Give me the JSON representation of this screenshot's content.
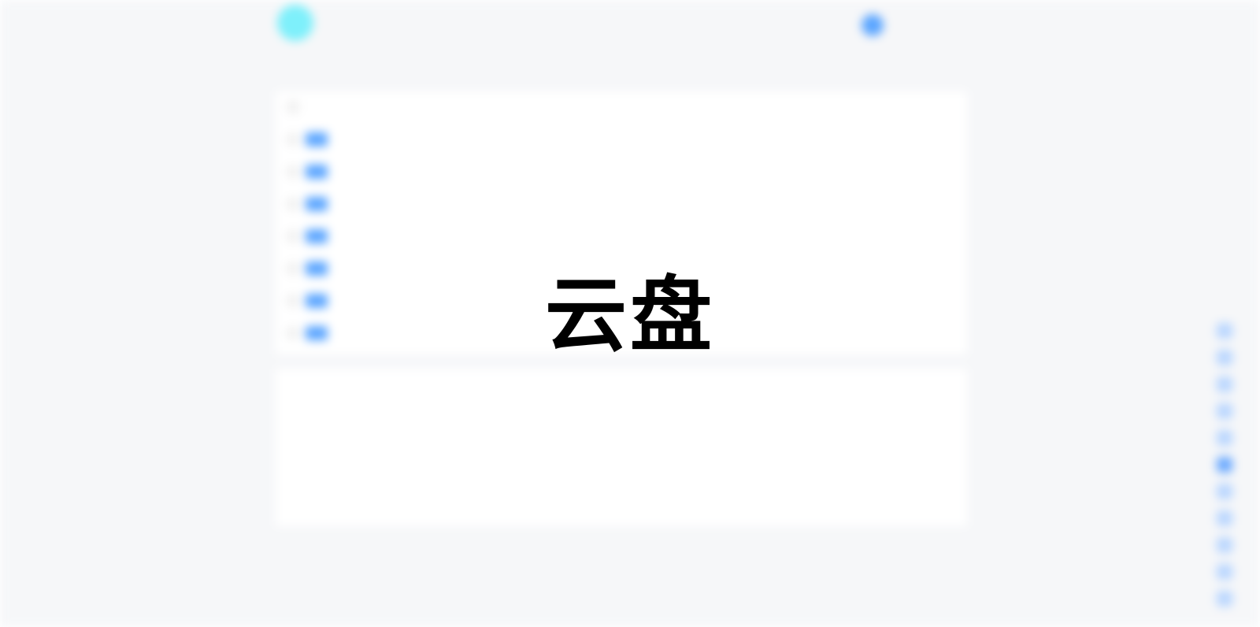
{
  "overlay": {
    "title": "云盘"
  },
  "colors": {
    "accent": "#5aa5ff",
    "logo": "#7ef0fb",
    "page_background": "#f6f7f9",
    "card_background": "#ffffff",
    "overlay_text": "#000000"
  },
  "icons": {
    "logo": "cloud-drive-logo",
    "folder": "folder-icon",
    "avatar": "user-avatar",
    "side_tools": [
      "tool-icon",
      "tool-icon",
      "tool-icon",
      "tool-icon",
      "tool-icon",
      "tool-icon",
      "tool-icon",
      "tool-icon",
      "tool-icon",
      "tool-icon",
      "tool-icon"
    ]
  }
}
